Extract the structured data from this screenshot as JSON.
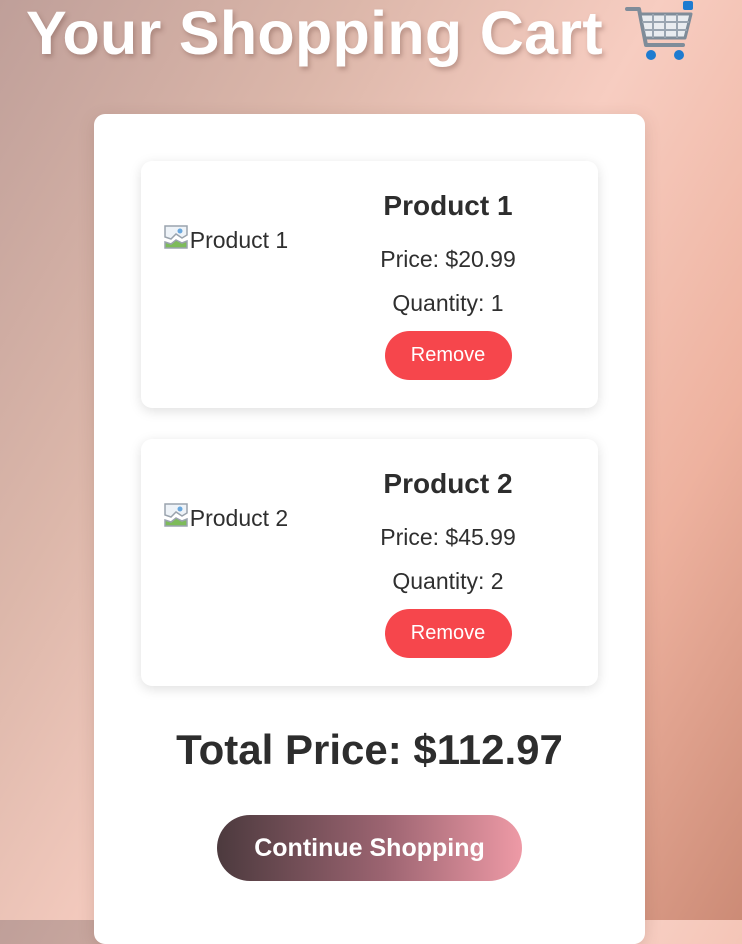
{
  "header": {
    "title": "Your Shopping Cart",
    "cart_icon": "shopping-cart-icon"
  },
  "cart": {
    "items": [
      {
        "image_alt": "Product 1",
        "name": "Product 1",
        "price": "Price: $20.99",
        "quantity": "Quantity: 1",
        "remove_label": "Remove"
      },
      {
        "image_alt": "Product 2",
        "name": "Product 2",
        "price": "Price: $45.99",
        "quantity": "Quantity: 2",
        "remove_label": "Remove"
      }
    ],
    "total": "Total Price: $112.97",
    "continue_label": "Continue Shopping"
  },
  "colors": {
    "remove_button": "#f6464c",
    "continue_gradient_start": "#4c3a3e",
    "continue_gradient_end": "#ee9aa6",
    "title_text": "#ffffff"
  }
}
